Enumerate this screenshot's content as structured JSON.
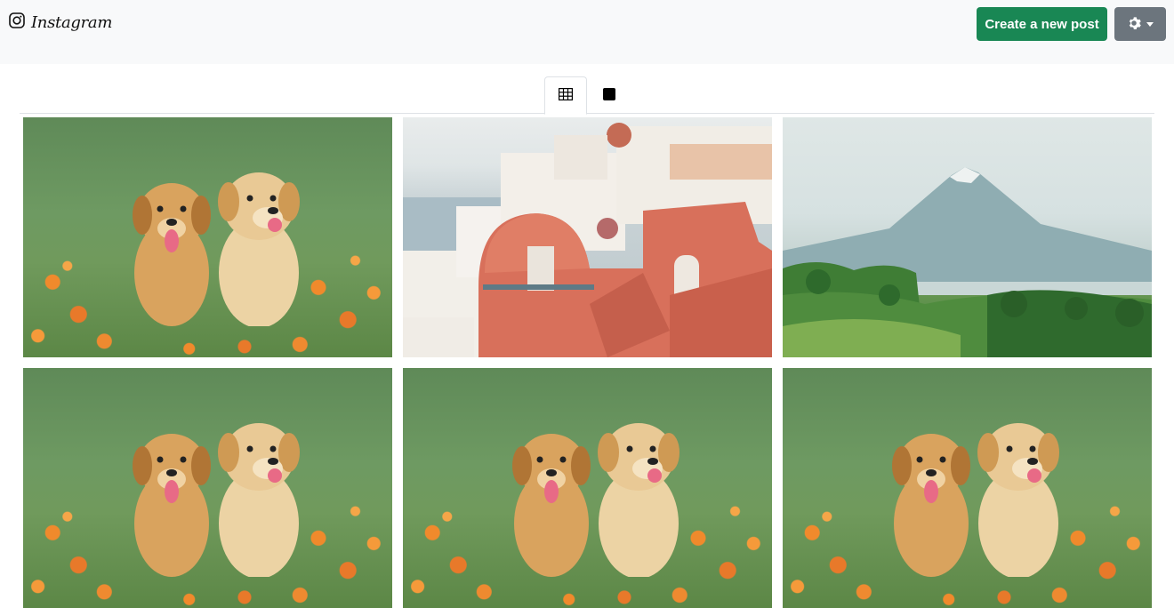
{
  "navbar": {
    "brand_name": "Instagram",
    "brand_icon": "instagram-icon",
    "create_button_label": "Create a new post",
    "settings_icon": "gear-icon",
    "colors": {
      "create_button": "#198754",
      "settings_button": "#6c757d",
      "navbar_bg": "#f8f9fa"
    }
  },
  "tabs": [
    {
      "icon": "grid-icon",
      "active": true
    },
    {
      "icon": "square-icon",
      "active": false
    }
  ],
  "posts": [
    {
      "image": "two golden retriever puppies in orange flowers"
    },
    {
      "image": "santorini white and red buildings"
    },
    {
      "image": "volcano mountain with green forest"
    },
    {
      "image": "two golden retriever puppies in orange flowers"
    },
    {
      "image": "two golden retriever puppies in orange flowers"
    },
    {
      "image": "two golden retriever puppies in orange flowers"
    }
  ]
}
